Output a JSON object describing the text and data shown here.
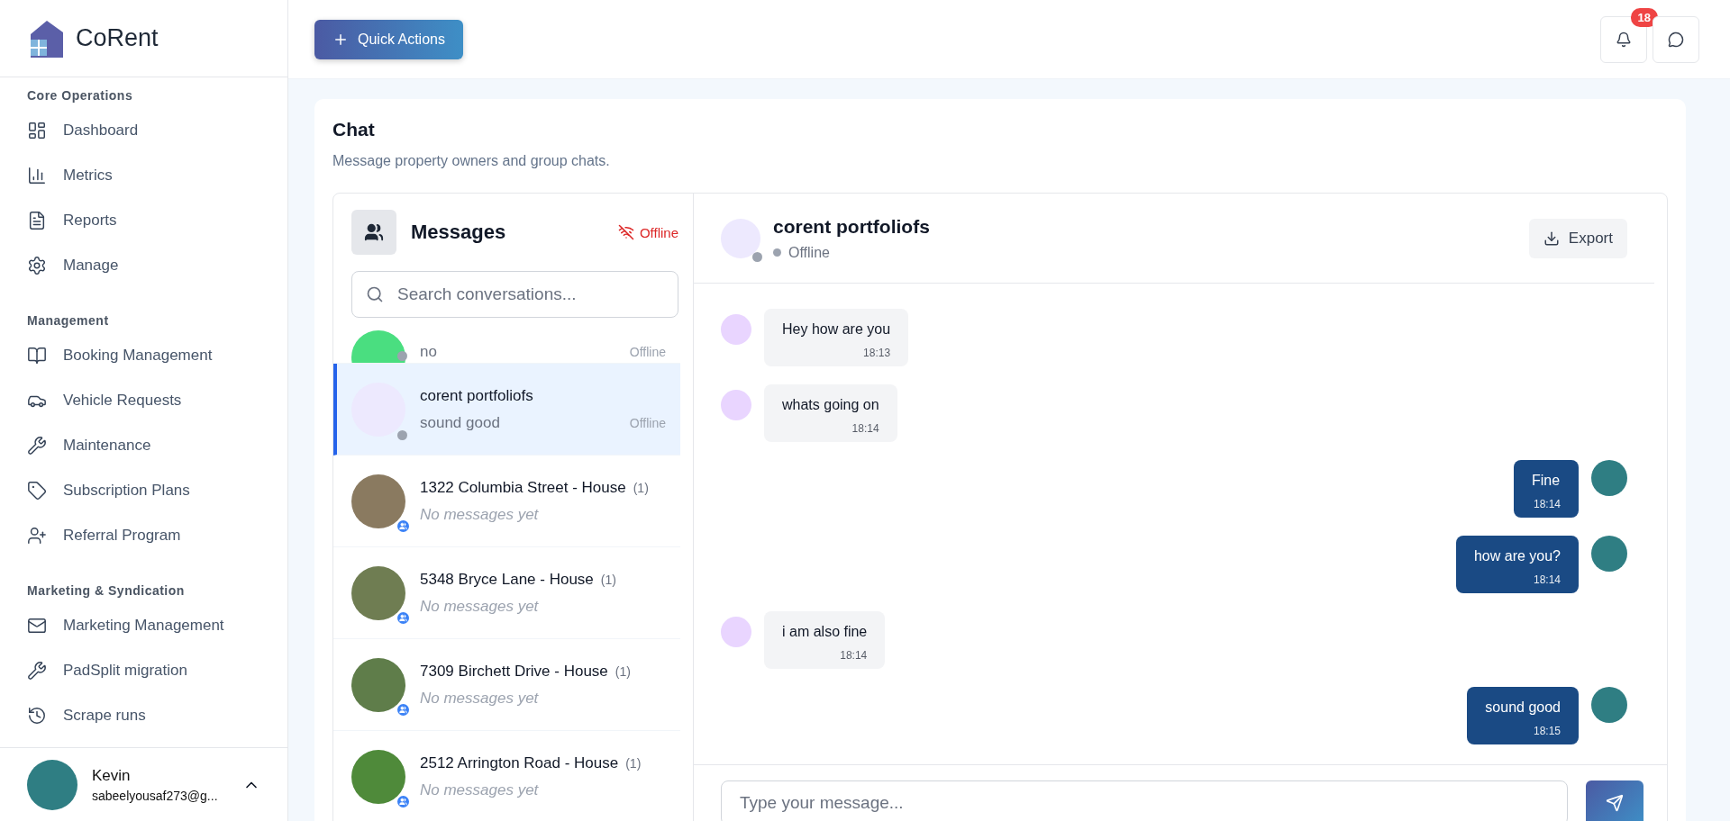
{
  "brand": {
    "name": "CoRent"
  },
  "sidebar": {
    "sections": [
      {
        "title": "Core Operations",
        "items": [
          {
            "label": "Dashboard"
          },
          {
            "label": "Metrics"
          },
          {
            "label": "Reports"
          },
          {
            "label": "Manage"
          }
        ]
      },
      {
        "title": "Management",
        "items": [
          {
            "label": "Booking Management"
          },
          {
            "label": "Vehicle Requests"
          },
          {
            "label": "Maintenance"
          },
          {
            "label": "Subscription Plans"
          },
          {
            "label": "Referral Program"
          }
        ]
      },
      {
        "title": "Marketing & Syndication",
        "items": [
          {
            "label": "Marketing Management"
          },
          {
            "label": "PadSplit migration"
          },
          {
            "label": "Scrape runs"
          }
        ]
      }
    ],
    "user": {
      "name": "Kevin",
      "email": "sabeelyousaf273@g..."
    }
  },
  "topbar": {
    "quick_action": "Quick Actions",
    "notification_count": "18"
  },
  "chat": {
    "title": "Chat",
    "subtitle": "Message property owners and group chats.",
    "list": {
      "title": "Messages",
      "connection": "Offline",
      "search": {
        "placeholder": "Search conversations..."
      },
      "conversations": [
        {
          "kind": "partial",
          "preview": "no",
          "status": "Offline",
          "selected": false
        },
        {
          "kind": "direct",
          "name": "corent portfoliofs",
          "preview": "sound good",
          "status": "Offline",
          "selected": true
        },
        {
          "kind": "group",
          "name": "1322 Columbia Street - House",
          "count": "(1)",
          "preview": "No messages yet",
          "selected": false
        },
        {
          "kind": "group",
          "name": "5348 Bryce Lane - House",
          "count": "(1)",
          "preview": "No messages yet",
          "selected": false
        },
        {
          "kind": "group",
          "name": "7309 Birchett Drive - House",
          "count": "(1)",
          "preview": "No messages yet",
          "selected": false
        },
        {
          "kind": "group",
          "name": "2512 Arrington Road - House",
          "count": "(1)",
          "preview": "No messages yet",
          "selected": false
        }
      ]
    },
    "thread": {
      "name": "corent portfoliofs",
      "status": "Offline",
      "export": "Export",
      "messages": [
        {
          "text": "Hey how are you",
          "time": "18:13",
          "outgoing": false
        },
        {
          "text": "whats going on",
          "time": "18:14",
          "outgoing": false
        },
        {
          "text": "Fine",
          "time": "18:14",
          "outgoing": true
        },
        {
          "text": "how are you?",
          "time": "18:14",
          "outgoing": true
        },
        {
          "text": "i am also fine",
          "time": "18:14",
          "outgoing": false
        },
        {
          "text": "sound good",
          "time": "18:15",
          "outgoing": true
        }
      ],
      "composer": {
        "placeholder": "Type your message..."
      }
    }
  }
}
